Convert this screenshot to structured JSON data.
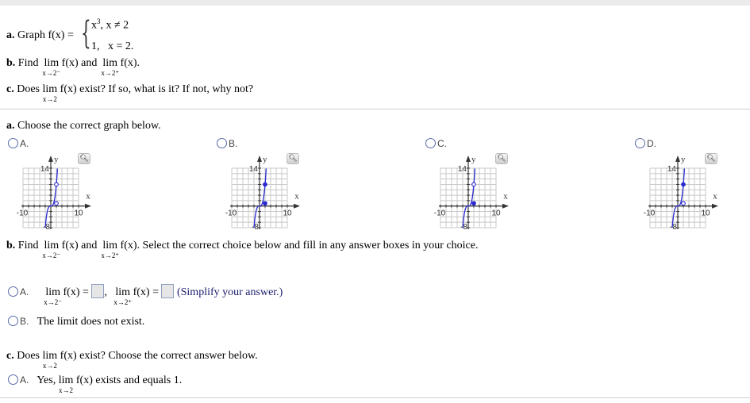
{
  "problem": {
    "part_a_label": "a.",
    "part_a_text": "Graph f(x) =",
    "piece1_expr": "x",
    "piece1_exp": "3",
    "piece1_cond": ",  x ≠ 2",
    "piece2_expr": "1,",
    "piece2_cond": "x = 2.",
    "part_b_label": "b.",
    "part_b_find": "Find",
    "lim": "lim",
    "fx": "f(x)",
    "and": "and",
    "fx_period": "f(x).",
    "sub_left": "x→2⁻",
    "sub_right": "x→2⁺",
    "sub_two": "x→2",
    "part_c_label": "c.",
    "part_c_does": "Does",
    "part_c_rest": "f(x) exist? If so, what is it? If not, why not?"
  },
  "section_a": {
    "prompt_label": "a.",
    "prompt_text": "Choose the correct graph below.",
    "options": [
      {
        "letter": "A.",
        "point_at_8": "open",
        "point_at_1": "open"
      },
      {
        "letter": "B.",
        "point_at_8": "filled",
        "point_at_1": "filled"
      },
      {
        "letter": "C.",
        "point_at_8": "open",
        "point_at_1": "filled"
      },
      {
        "letter": "D.",
        "point_at_8": "filled",
        "point_at_1": "open"
      }
    ],
    "graph": {
      "xlabel": "x",
      "ylabel": "y",
      "xmin_label": "-10",
      "xmax_label": "10",
      "ymax_label": "14",
      "ymin_label": "-8",
      "xlim": [
        -10,
        10
      ],
      "ylim": [
        -8,
        14
      ],
      "curve_color": "#2a2ad0",
      "zoom_icon": "magnifier-plus-icon"
    }
  },
  "section_b": {
    "prompt_label": "b.",
    "prompt_find": "Find",
    "prompt_rest": "f(x). Select the correct choice below and fill in any answer boxes in your choice.",
    "option_a_letter": "A.",
    "eq": "f(x) =",
    "comma": ",",
    "simplify": "(Simplify your answer.)",
    "option_b_letter": "B.",
    "option_b_text": "The limit does not exist.",
    "answer_left_value": "",
    "answer_right_value": ""
  },
  "section_c": {
    "prompt_label": "c.",
    "prompt_does": "Does",
    "prompt_rest": "f(x) exist? Choose the correct answer below.",
    "option_a_letter": "A.",
    "option_a_yes": "Yes,",
    "option_a_rest": "f(x) exists and equals 1."
  },
  "colors": {
    "radio_border": "#5a6aa8",
    "navy_text": "#1a1a6e",
    "separator": "#cfcfcf",
    "topbar": "#ebebeb"
  }
}
